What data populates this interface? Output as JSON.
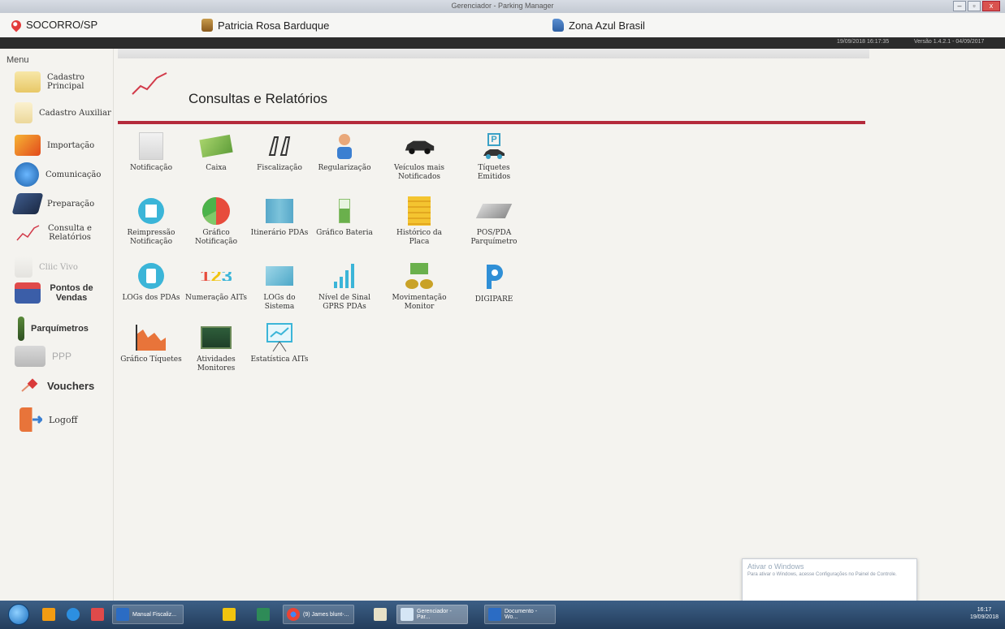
{
  "window": {
    "title": "Gerenciador - Parking Manager",
    "min": "–",
    "max": "▫",
    "close": "x"
  },
  "infobar": {
    "city": "SOCORRO/SP",
    "user": "Patricia Rosa Barduque",
    "company": "Zona Azul Brasil"
  },
  "status": {
    "datetime": "19/09/2018 16:17:35",
    "version": "Versão 1.4.2.1 - 04/09/2017"
  },
  "sidebar": {
    "title": "Menu",
    "items": [
      {
        "label": "Cadastro Principal"
      },
      {
        "label": "Cadastro Auxiliar"
      },
      {
        "label": "Importação"
      },
      {
        "label": "Comunicação"
      },
      {
        "label": "Preparação"
      },
      {
        "label": "Consulta e Relatórios"
      },
      {
        "label": "Cliic Vivo"
      },
      {
        "label": "Pontos de Vendas"
      },
      {
        "label": "Parquímetros"
      },
      {
        "label": "PPP"
      },
      {
        "label": "Vouchers"
      },
      {
        "label": "Logoff"
      }
    ]
  },
  "main": {
    "title": "Consultas e Relatórios",
    "tiles": [
      {
        "label": "Notificação"
      },
      {
        "label": "Caixa"
      },
      {
        "label": "Fiscalização"
      },
      {
        "label": "Regularização"
      },
      {
        "label": "Veículos mais Notificados"
      },
      {
        "label": "Tíquetes Emitidos"
      },
      {
        "label": "Reimpressão Notificação"
      },
      {
        "label": "Gráfico Notificação"
      },
      {
        "label": "Itinerário PDAs"
      },
      {
        "label": "Gráfico Bateria"
      },
      {
        "label": "Histórico da Placa"
      },
      {
        "label": "POS/PDA Parquímetro"
      },
      {
        "label": "LOGs dos PDAs"
      },
      {
        "label": "Numeração AITs"
      },
      {
        "label": "LOGs do Sistema"
      },
      {
        "label": "Nível de Sinal GPRS PDAs"
      },
      {
        "label": "Movimentação Monitor"
      },
      {
        "label": "DIGIPARE"
      },
      {
        "label": "Gráfico Tíquetes"
      },
      {
        "label": "Atividades Monitores"
      },
      {
        "label": "Estatística AITs"
      }
    ],
    "numeracao_glyph": "123",
    "tickets_glyph": "P"
  },
  "taskbar": {
    "items": [
      {
        "label": "Manual Fiscaliz..."
      },
      {
        "label": "(9) James blunt-..."
      },
      {
        "label": "Gerenciador - Par..."
      },
      {
        "label": "Documento - Wo..."
      }
    ],
    "time": "16:17",
    "date": "19/09/2018"
  },
  "notification": {
    "title": "Ativar o Windows",
    "text": "Para ativar o Windows, acesse Configurações no Painel de Controle."
  },
  "colors": {
    "accent_line": "#b42a3b",
    "taskbar": "#2d4a6e"
  }
}
